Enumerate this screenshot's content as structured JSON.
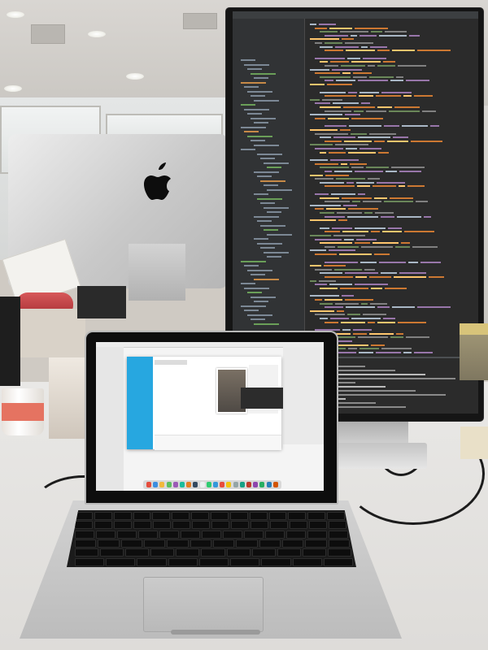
{
  "scene": {
    "description_colors": {
      "desk": "#e4e2df",
      "monitor_bezel": "#151515",
      "ide_background": "#2b2b2b",
      "laptop_app_sidebar": "#27a7e0",
      "cup_band": "#e57361"
    }
  }
}
